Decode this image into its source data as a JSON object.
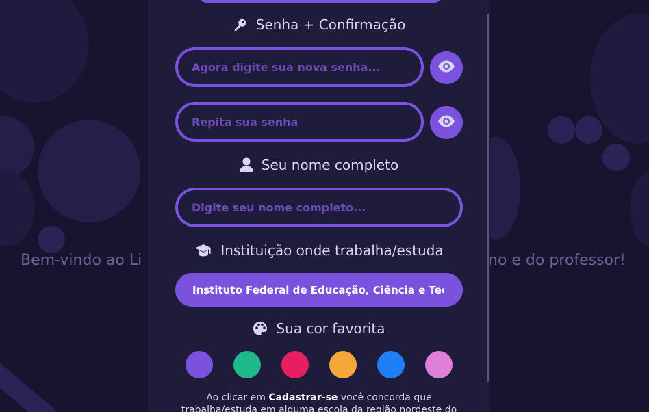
{
  "background": {
    "welcome_left": "Bem-vindo ao Li",
    "welcome_right": "no e do professor!"
  },
  "form": {
    "password_section": {
      "title": "Senha + Confirmação",
      "password_placeholder": "Agora digite sua nova senha...",
      "confirm_placeholder": "Repita sua senha"
    },
    "name_section": {
      "title": "Seu nome completo",
      "name_placeholder": "Digite seu nome completo..."
    },
    "institution_section": {
      "title": "Instituição onde trabalha/estuda",
      "selected": "Instituto Federal de Educação, Ciência e Tecnologia"
    },
    "color_section": {
      "title": "Sua cor favorita",
      "colors": [
        "#7b52dd",
        "#1fb88a",
        "#e81e63",
        "#f5a83a",
        "#1f7ff5",
        "#e07fd6"
      ]
    },
    "terms": {
      "prefix": "Ao clicar em",
      "action": "Cadastrar-se",
      "suffix": "você concorda que",
      "line2": "trabalha/estuda em alguma escola da região nordeste do"
    }
  },
  "icons": {
    "key": "key-icon",
    "eye": "eye-icon",
    "user": "user-icon",
    "graduation": "graduation-cap-icon",
    "palette": "palette-icon",
    "chevron": "chevron-down-icon"
  },
  "theme": {
    "accent": "#7b52dd",
    "modal_bg": "#1e1c3a",
    "page_bg": "#171430"
  }
}
